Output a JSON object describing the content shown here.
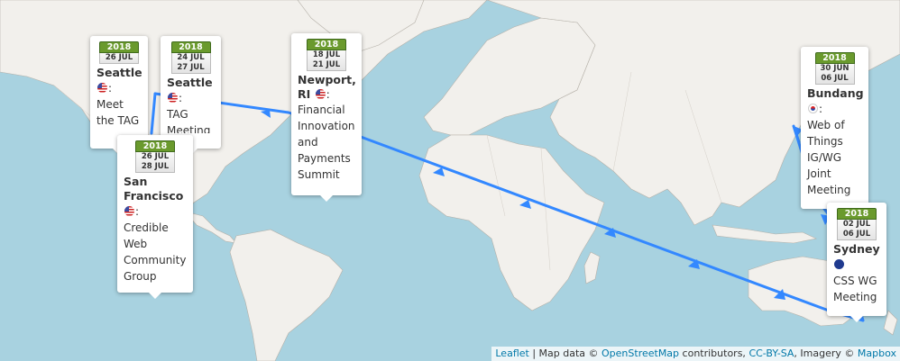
{
  "colors": {
    "water": "#a8d2e0",
    "land": "#f2f0ec",
    "route": "#3388ff",
    "calendar_green": "#6a9a2d"
  },
  "events": [
    {
      "year": "2018",
      "dates": [
        "26 JUL"
      ],
      "city": "Seattle",
      "flag": "flag-us-icon",
      "sep": ":",
      "desc": [
        "Meet",
        "the TAG"
      ]
    },
    {
      "year": "2018",
      "dates": [
        "24 JUL",
        "27 JUL"
      ],
      "city": "Seattle",
      "flag": "flag-us-icon",
      "sep": ":",
      "desc": [
        "TAG",
        "Meeting"
      ]
    },
    {
      "year": "2018",
      "dates": [
        "26 JUL",
        "28 JUL"
      ],
      "city": "San Francisco",
      "flag": "flag-us-icon",
      "sep": ":",
      "desc": [
        "Credible",
        "Web",
        "Community",
        "Group"
      ]
    },
    {
      "year": "2018",
      "dates": [
        "18 JUL",
        "21 JUL"
      ],
      "city": "Newport, RI",
      "flag": "flag-us-icon",
      "sep": ":",
      "desc": [
        "Financial",
        "Innovation",
        "and",
        "Payments",
        "Summit"
      ]
    },
    {
      "year": "2018",
      "dates": [
        "30 JUN",
        "06 JUL"
      ],
      "city": "Bundang",
      "flag": "flag-kr-icon",
      "sep": ":",
      "desc": [
        "Web of",
        "Things",
        "IG/WG",
        "Joint",
        "Meeting"
      ]
    },
    {
      "year": "2018",
      "dates": [
        "02 JUL",
        "06 JUL"
      ],
      "city": "Sydney",
      "flag": "flag-au-icon",
      "sep": "",
      "desc": [
        "CSS WG",
        "Meeting"
      ]
    }
  ],
  "attribution": {
    "leaflet": "Leaflet",
    "sep1": " | Map data © ",
    "osm": "OpenStreetMap",
    "mid": " contributors, ",
    "license": "CC-BY-SA",
    "imagery": ", Imagery © ",
    "mapbox": "Mapbox"
  }
}
